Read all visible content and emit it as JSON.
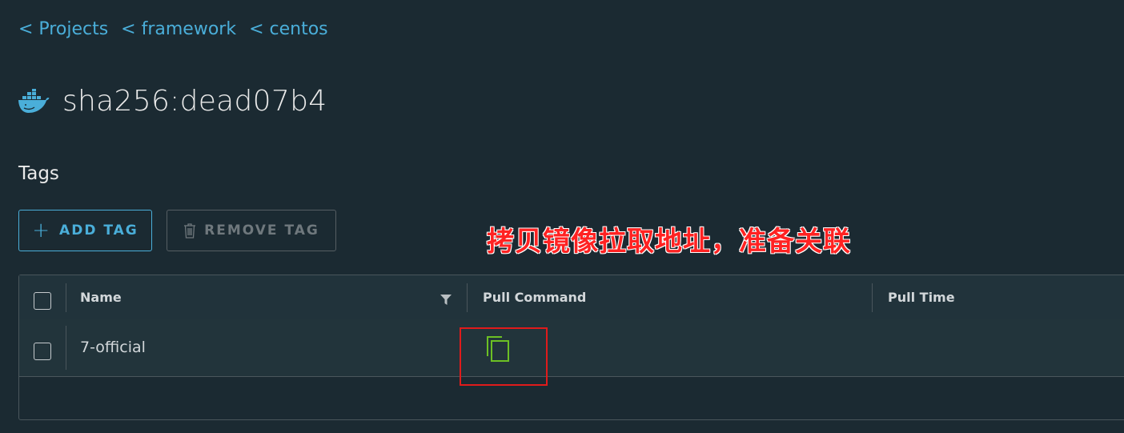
{
  "breadcrumb": {
    "items": [
      "< Projects",
      "< framework",
      "< centos"
    ]
  },
  "header": {
    "icon": "docker-whale-icon",
    "title": "sha256:dead07b4"
  },
  "tags_section": {
    "title": "Tags",
    "add_button": "ADD TAG",
    "remove_button": "REMOVE TAG"
  },
  "annotation": {
    "text": "拷贝镜像拉取地址，准备关联",
    "color": "#ff2222"
  },
  "grid": {
    "columns": [
      "Name",
      "Pull Command",
      "Pull Time"
    ],
    "rows": [
      {
        "name": "7-official",
        "pull_command_icon": "copy-icon",
        "pull_time": ""
      }
    ]
  },
  "colors": {
    "accent": "#4aaed9",
    "background": "#1b2a32",
    "copy_icon": "#6cc024"
  }
}
